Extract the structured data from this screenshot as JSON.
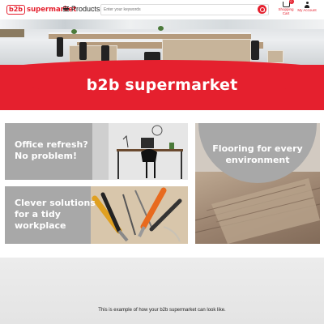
{
  "header": {
    "logo_mark": "b2b",
    "logo_text": "supermarket",
    "products_label": "Products",
    "search_placeholder": "Enter your keywords",
    "cart_label": "Shopping Cart",
    "cart_count": "0",
    "account_label": "My Account"
  },
  "hero": {
    "title": "b2b supermarket"
  },
  "tiles": [
    {
      "text": "Office refresh? No problem!"
    },
    {
      "text": "Clever solutions for a tidy workplace"
    },
    {
      "text": "Flooring for every environment"
    }
  ],
  "bottom": {
    "text": "This is example of how your b2b supermarket can look like."
  },
  "colors": {
    "brand_red": "#e5202e",
    "tile_grey": "#a8a8a8"
  }
}
